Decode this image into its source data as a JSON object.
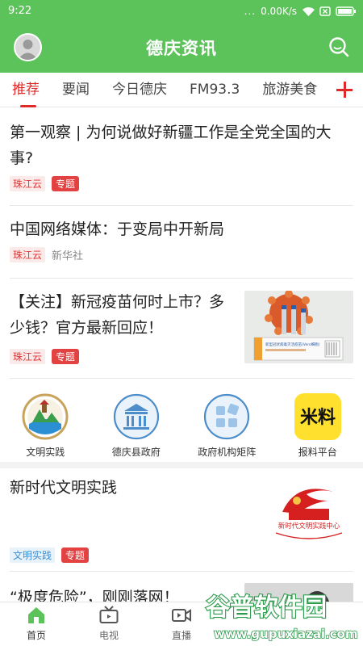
{
  "status": {
    "time": "9:22",
    "dots": "...",
    "speed": "0.00K/s"
  },
  "app": {
    "title": "德庆资讯",
    "brand_color": "#5cc25a",
    "accent_color": "#e02a2a"
  },
  "tabs": [
    "推荐",
    "要闻",
    "今日德庆",
    "FM93.3",
    "旅游美食"
  ],
  "feed": [
    {
      "title": "第一观察 | 为何说做好新疆工作是全党全国的大事?",
      "source": "珠江云",
      "badge": "专题"
    },
    {
      "title": "中国网络媒体：于变局中开新局",
      "source": "珠江云",
      "author": "新华社"
    },
    {
      "title": "【关注】新冠疫苗何时上市？多少钱？官方最新回应！",
      "source": "珠江云",
      "badge": "专题"
    },
    {
      "title": "新时代文明实践",
      "source": "文明实践",
      "badge": "专题"
    },
    {
      "title": "“极度危险”，刚刚落网！"
    }
  ],
  "shortcuts": [
    {
      "label": "文明实践",
      "icon": "civilization-practice-icon"
    },
    {
      "label": "德庆县政府",
      "icon": "government-building-icon"
    },
    {
      "label": "政府机构矩阵",
      "icon": "matrix-grid-icon"
    },
    {
      "label": "报料平台",
      "icon": "report-platform-icon",
      "glyph": "米料"
    }
  ],
  "thumb_texts": {
    "vaccine_box": "新型冠状病毒灭活疫苗(Vero细胞)",
    "banner": "新时代文明实践中心"
  },
  "bottom_nav": [
    {
      "label": "首页",
      "icon": "home-icon"
    },
    {
      "label": "电视",
      "icon": "tv-icon"
    },
    {
      "label": "直播",
      "icon": "live-video-icon"
    }
  ],
  "watermark": {
    "title": "谷普软件园",
    "url": "www.gupuxiazai.com"
  }
}
